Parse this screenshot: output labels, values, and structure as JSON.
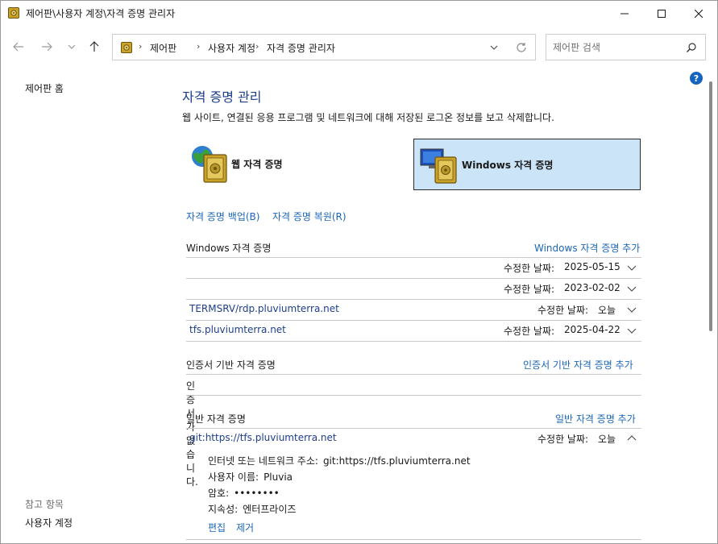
{
  "window": {
    "title": "제어판\\사용자 계정\\자격 증명 관리자",
    "icon": "vault-icon"
  },
  "address": {
    "crumbs": [
      "제어판",
      "사용자 계정",
      "자격 증명 관리자"
    ]
  },
  "search": {
    "placeholder": "제어판 검색"
  },
  "leftpane": {
    "home": "제어판 홈",
    "see_also": "참고 항목",
    "user_accounts": "사용자 계정"
  },
  "main": {
    "title": "자격 증명 관리",
    "description": "웹 사이트, 연결된 응용 프로그램 및 네트워크에 대해 저장된 로그온 정보를 보고 삭제합니다.",
    "tiles": {
      "web": "웹 자격 증명",
      "windows": "Windows 자격 증명"
    },
    "backup": "자격 증명 백업(B)",
    "restore": "자격 증명 복원(R)",
    "windows_section": {
      "title": "Windows 자격 증명",
      "add": "Windows 자격 증명 추가",
      "rows": [
        {
          "name": "",
          "date_label": "수정한 날짜:",
          "date": "2025-05-15"
        },
        {
          "name": "",
          "date_label": "수정한 날짜:",
          "date": "2023-02-02"
        },
        {
          "name": "TERMSRV/rdp.pluviumterra.net",
          "date_label": "수정한 날짜:",
          "date": "오늘"
        },
        {
          "name": "tfs.pluviumterra.net",
          "date_label": "수정한 날짜:",
          "date": "2025-04-22"
        }
      ]
    },
    "cert_section": {
      "title": "인증서 기반 자격 증명",
      "add": "인증서 기반 자격 증명 추가",
      "empty": "인증서가 없습니다."
    },
    "generic_section": {
      "title": "일반 자격 증명",
      "add": "일반 자격 증명 추가",
      "row": {
        "name": "git:https://tfs.pluviumterra.net",
        "date_label": "수정한 날짜:",
        "date": "오늘"
      },
      "details": {
        "address_label": "인터넷 또는 네트워크 주소:",
        "address": "git:https://tfs.pluviumterra.net",
        "user_label": "사용자 이름:",
        "user": "Pluvia",
        "password_label": "암호:",
        "password": "••••••••",
        "persistence_label": "지속성:",
        "persistence": "엔터프라이즈",
        "edit": "편집",
        "remove": "제거"
      }
    }
  },
  "colors": {
    "link": "#1a66b8",
    "heading": "#1e3e8c",
    "selected_tile": "#cce4f7",
    "help": "#1565c0"
  }
}
